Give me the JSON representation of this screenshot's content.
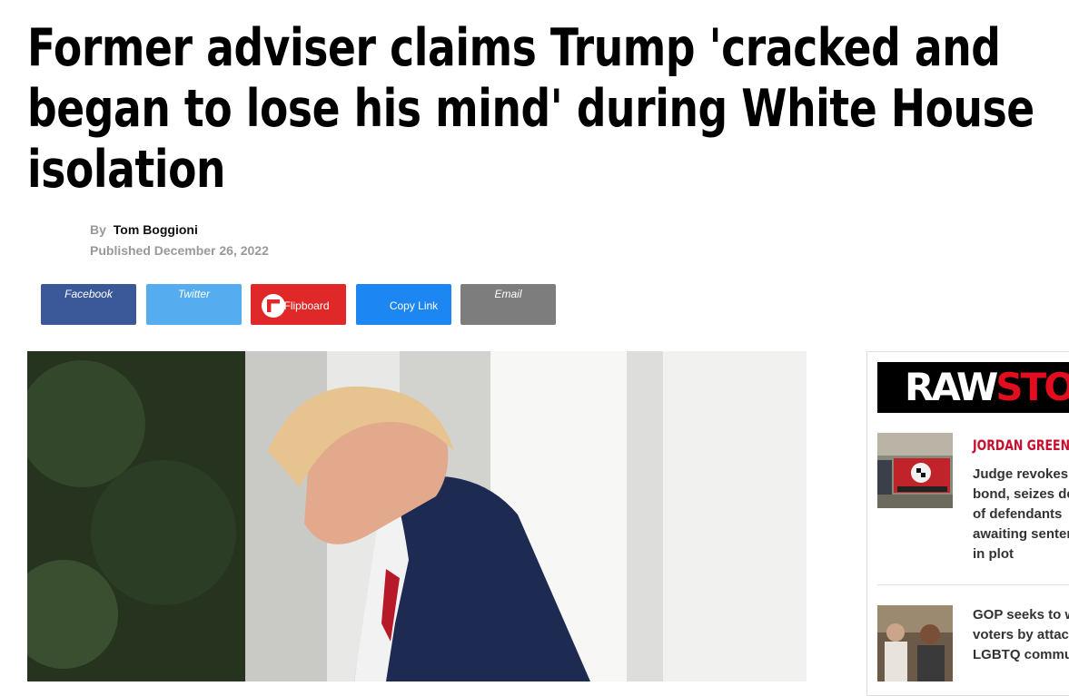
{
  "article": {
    "headline": "Former adviser claims Trump 'cracked and began to lose his mind' during White House isolation",
    "by_label": "By",
    "author": "Tom Boggioni",
    "published": "Published December 26, 2022"
  },
  "share": {
    "facebook": "Facebook",
    "twitter": "Twitter",
    "flipboard": "Flipboard",
    "copy_link": "Copy Link",
    "email": "Email"
  },
  "sidebar": {
    "logo_text_a": "RAW",
    "logo_text_b": "STORY",
    "story1": {
      "kicker": "JORDAN GREEN",
      "title": "Judge revokes bond, seizes devices of defendants awaiting sentencing in plot"
    },
    "story2": {
      "title": "GOP seeks to win voters by attacking LGBTQ community"
    }
  },
  "colors": {
    "facebook": "#3b5998",
    "twitter": "#55acee",
    "flipboard": "#e12828",
    "copy_link": "#1c86f2",
    "email": "#7d7d7d",
    "kicker": "#c8102e"
  }
}
